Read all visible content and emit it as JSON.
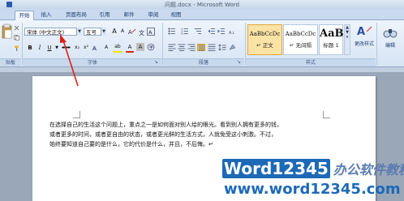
{
  "window": {
    "title": "问题.docx - Microsoft Word"
  },
  "tabs": [
    "开始",
    "插入",
    "页面布局",
    "引用",
    "邮件",
    "审阅",
    "视图"
  ],
  "active_tab": "开始",
  "ribbon": {
    "clipboard_label": "贴板",
    "font_name": "宋体 (中文正文)",
    "font_size": "五号",
    "font_group_label": "字体",
    "paragraph_group_label": "段落",
    "styles_group_label": "样式",
    "styles": [
      {
        "sample": "AaBbCcDc",
        "name": "↵ 正文"
      },
      {
        "sample": "AaBbCcDc",
        "name": "↵ 无间隔"
      },
      {
        "sample": "AaBl",
        "name": "标题 1"
      }
    ],
    "change_styles_label": "更改样式",
    "editing_label": "编辑",
    "buttons": {
      "bold": "B",
      "italic": "I",
      "underline": "U",
      "strikethrough": "abe",
      "subscript": "x₂",
      "superscript": "x²",
      "grow": "A",
      "shrink": "A",
      "highlight": "ab",
      "font_color": "A",
      "char_shade": "A"
    }
  },
  "document": {
    "lines": [
      "在选择自己的生活这个问题上，重点之一是如何面对别人给的眼光。看到别人拥有更多的钱，",
      "或者更多的时间，或者更自由的状态，或者更光鲜的生活方式，人就免受这小刺激。不过，",
      "始终要知道自己要的是什么，它的代价是什么，并且，不后悔。↵"
    ]
  },
  "watermark": {
    "brand": "Word12345",
    "brand_cn": "办公软件教程",
    "url": "www.word12345.com"
  },
  "colors": {
    "arrow": "#e0201a",
    "watermark": "#1d69b7",
    "ribbon": "#dbe7f5"
  }
}
